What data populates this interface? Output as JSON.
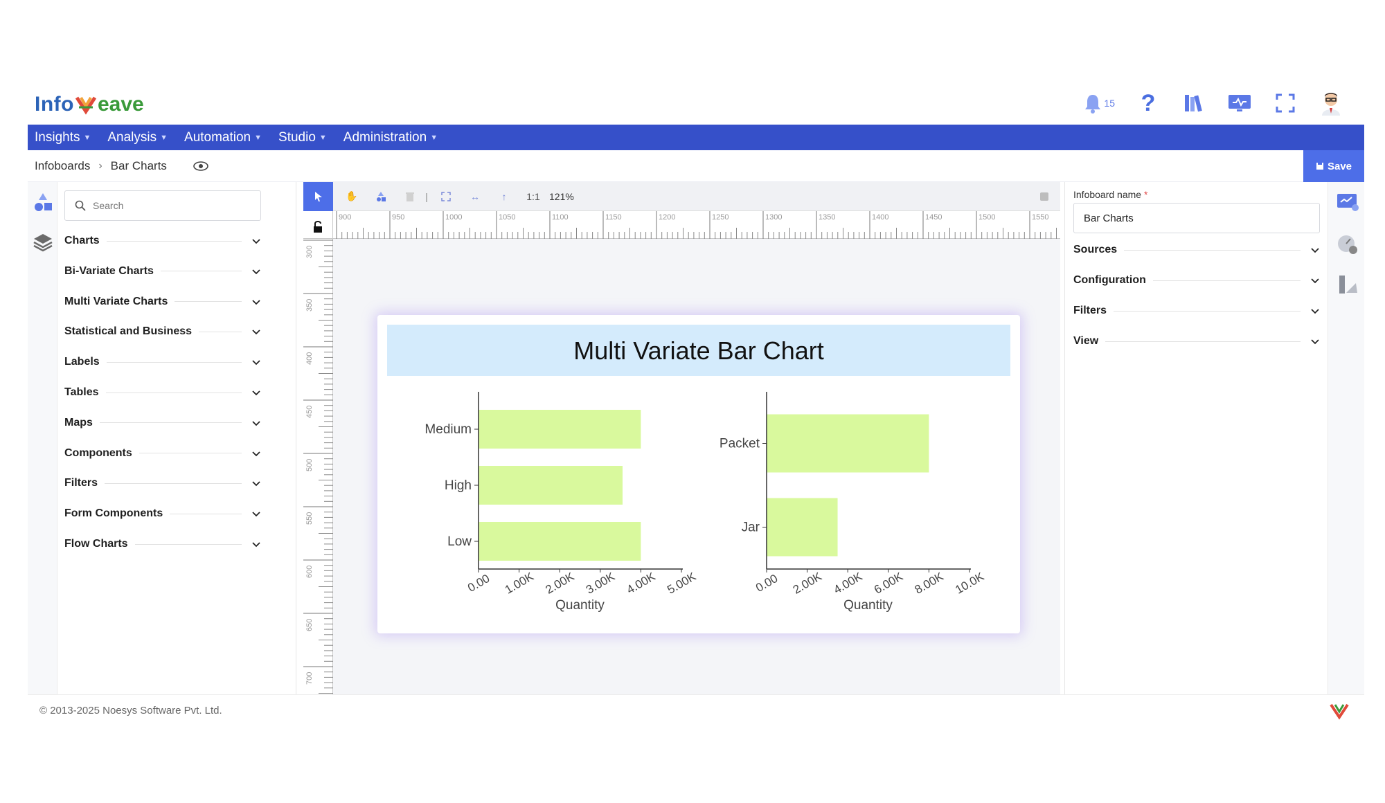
{
  "brand": {
    "logo_pre": "Info",
    "logo_post": "eave"
  },
  "header": {
    "notification_count": "15"
  },
  "nav": {
    "items": [
      "Insights",
      "Analysis",
      "Automation",
      "Studio",
      "Administration"
    ]
  },
  "breadcrumb": {
    "root": "Infoboards",
    "current": "Bar Charts"
  },
  "toolbar": {
    "save_label": "Save",
    "ratio_label": "1:1",
    "zoom": "121%"
  },
  "library": {
    "search_placeholder": "Search",
    "categories": [
      "Charts",
      "Bi-Variate Charts",
      "Multi Variate Charts",
      "Statistical and Business",
      "Labels",
      "Tables",
      "Maps",
      "Components",
      "Filters",
      "Form Components",
      "Flow Charts"
    ]
  },
  "rulers": {
    "horizontal": [
      "900",
      "950",
      "1000",
      "1050",
      "1100",
      "1150",
      "1200",
      "1250",
      "1300",
      "1350",
      "1400",
      "1450",
      "1500",
      "1550"
    ],
    "vertical": [
      "300",
      "350",
      "400",
      "450",
      "500",
      "550",
      "600",
      "650",
      "700"
    ]
  },
  "properties": {
    "name_label": "Infoboard name",
    "name_value": "Bar Charts",
    "sections": [
      "Sources",
      "Configuration",
      "Filters",
      "View"
    ]
  },
  "footer": {
    "copyright": "© 2013-2025 Noesys Software Pvt. Ltd."
  },
  "colors": {
    "nav": "#3650c9",
    "accent": "#4d6ee8",
    "bar": "#d9f99d",
    "title_band": "#d4ebfc"
  },
  "chart_data": {
    "type": "bar",
    "orientation": "horizontal",
    "title": "Multi Variate Bar Chart",
    "panels": [
      {
        "categories": [
          "Medium",
          "High",
          "Low"
        ],
        "values": [
          4000,
          3550,
          4000
        ],
        "xlabel": "Quantity",
        "xlim": [
          0,
          5000
        ],
        "ticks": [
          "0.00",
          "1.00K",
          "2.00K",
          "3.00K",
          "4.00K",
          "5.00K"
        ]
      },
      {
        "categories": [
          "Packet",
          "Jar"
        ],
        "values": [
          8000,
          3500
        ],
        "xlabel": "Quantity",
        "xlim": [
          0,
          10000
        ],
        "ticks": [
          "0.00",
          "2.00K",
          "4.00K",
          "6.00K",
          "8.00K",
          "10.0K"
        ]
      }
    ]
  }
}
